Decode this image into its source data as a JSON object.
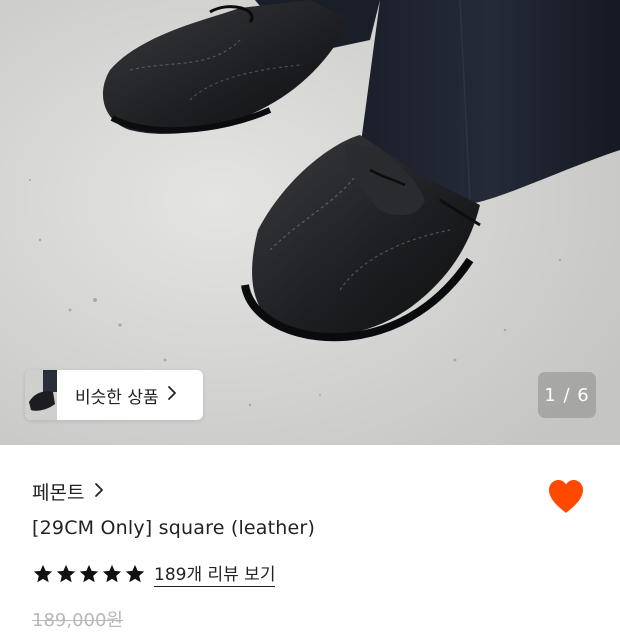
{
  "gallery": {
    "similar_label": "비슷한 상품",
    "counter": "1 / 6"
  },
  "product": {
    "brand": "페몬트",
    "title": "[29CM Only] square (leather)",
    "rating": 5,
    "reviews_label": "189개 리뷰 보기",
    "original_price": "189,000원",
    "wishlist_color": "#ff4800"
  },
  "icons": {
    "brand_chevron": "chevron-right-icon",
    "similar_chevron": "chevron-right-icon",
    "wishlist": "heart-icon",
    "star": "star-icon"
  }
}
